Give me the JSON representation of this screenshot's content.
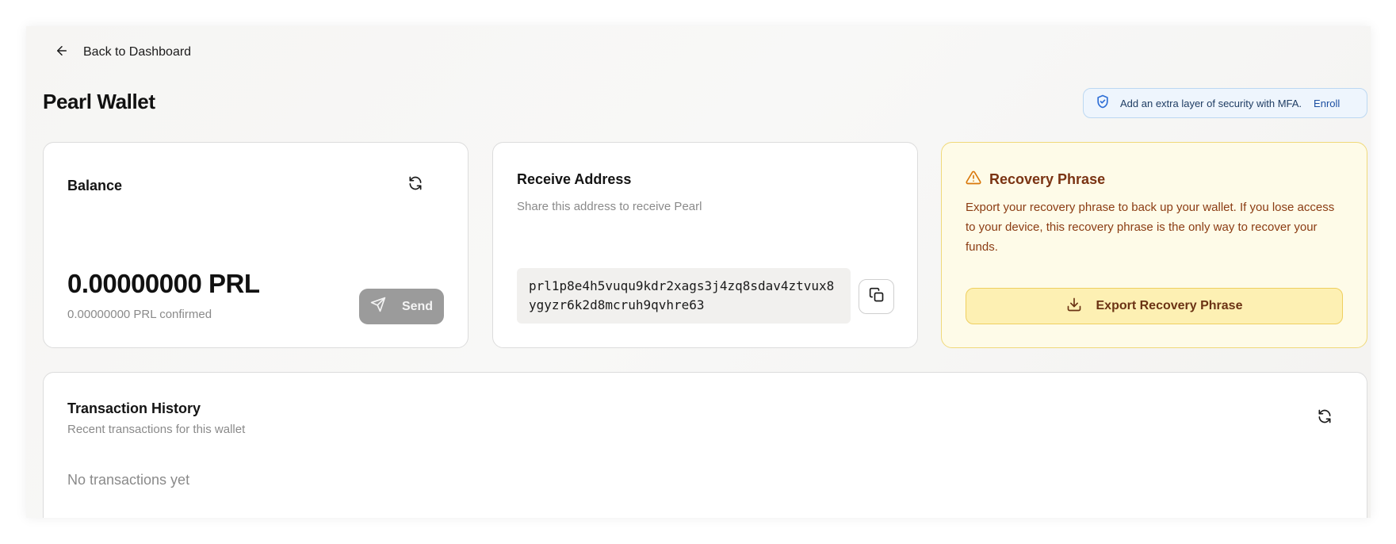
{
  "nav": {
    "back_label": "Back to Dashboard"
  },
  "page": {
    "title": "Pearl Wallet"
  },
  "mfa_banner": {
    "text": "Add an extra layer of security with MFA.",
    "link_label": "Enroll",
    "icon": "shield-check-icon"
  },
  "balance_card": {
    "title": "Balance",
    "amount": "0.00000000 PRL",
    "confirmed": "0.00000000 PRL confirmed",
    "send_label": "Send",
    "refresh_icon": "refresh-icon",
    "send_icon": "send-icon"
  },
  "receive_card": {
    "title": "Receive Address",
    "subtitle": "Share this address to receive Pearl",
    "address": "prl1p8e4h5vuqu9kdr2xags3j4zq8sdav4ztvux8ygyzr6k2d8mcruh9qvhre63",
    "copy_icon": "copy-icon"
  },
  "recovery_card": {
    "title": "Recovery Phrase",
    "description": "Export your recovery phrase to back up your wallet. If you lose access to your device, this recovery phrase is the only way to recover your funds.",
    "export_label": "Export Recovery Phrase",
    "warning_icon": "warning-triangle-icon",
    "download_icon": "download-icon"
  },
  "history_card": {
    "title": "Transaction History",
    "subtitle": "Recent transactions for this wallet",
    "empty_message": "No transactions yet",
    "refresh_icon": "refresh-icon"
  },
  "colors": {
    "mfa_border": "#bcd8f2",
    "mfa_background": "#eef5fd",
    "recovery_background": "#fefbe8",
    "recovery_border": "#f0d97a",
    "export_button": "#fdf0b3",
    "send_button_disabled": "#9b9b9b"
  }
}
